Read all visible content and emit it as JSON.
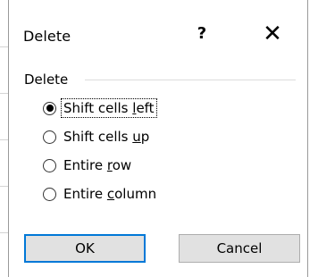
{
  "dialog": {
    "title": "Delete",
    "help_label": "?",
    "close_label": "✕"
  },
  "group": {
    "label": "Delete",
    "options": [
      {
        "pre": "Shift cells ",
        "key": "l",
        "post": "eft",
        "selected": true
      },
      {
        "pre": "Shift cells ",
        "key": "u",
        "post": "p",
        "selected": false
      },
      {
        "pre": "Entire ",
        "key": "r",
        "post": "ow",
        "selected": false
      },
      {
        "pre": "Entire ",
        "key": "c",
        "post": "olumn",
        "selected": false
      }
    ]
  },
  "buttons": {
    "ok_label": "OK",
    "cancel_label": "Cancel"
  },
  "colors": {
    "default_button_border": "#0078d7",
    "button_face": "#e1e1e1"
  }
}
